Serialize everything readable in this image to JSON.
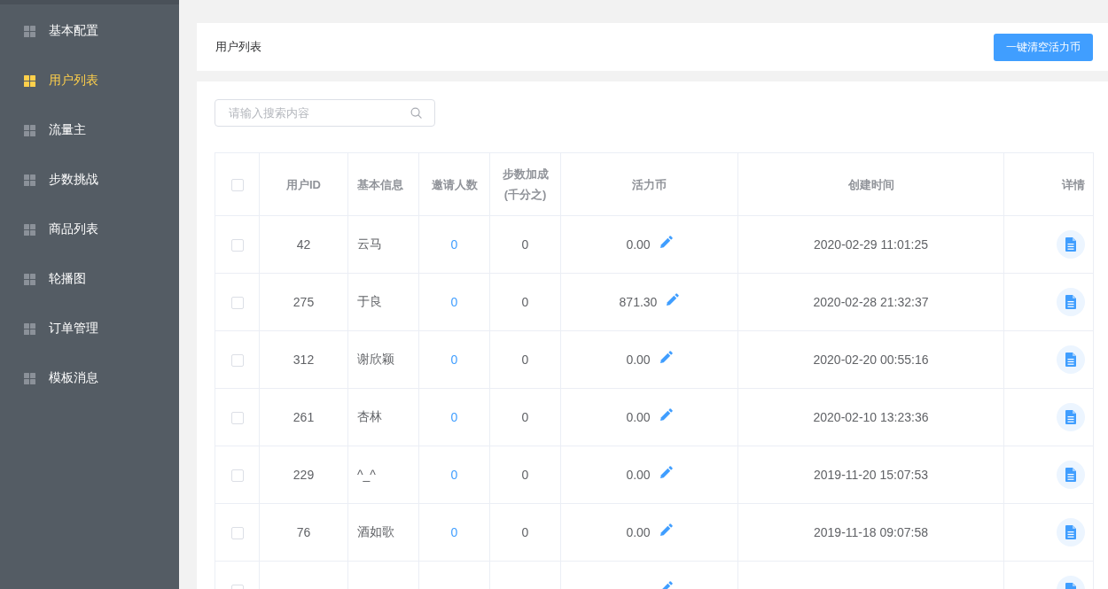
{
  "sidebar": {
    "items": [
      {
        "label": "基本配置",
        "selected": false
      },
      {
        "label": "用户列表",
        "selected": true
      },
      {
        "label": "流量主",
        "selected": false
      },
      {
        "label": "步数挑战",
        "selected": false
      },
      {
        "label": "商品列表",
        "selected": false
      },
      {
        "label": "轮播图",
        "selected": false
      },
      {
        "label": "订单管理",
        "selected": false
      },
      {
        "label": "模板消息",
        "selected": false
      }
    ]
  },
  "header": {
    "title": "用户列表",
    "button": "一键清空活力币"
  },
  "search": {
    "placeholder": "请输入搜索内容"
  },
  "table": {
    "all_checked": false,
    "columns": [
      "用户ID",
      "基本信息",
      "邀请人数",
      "步数加成(千分之)",
      "活力币",
      "创建时间",
      "详情"
    ],
    "rows": [
      {
        "checked": false,
        "id": "42",
        "name": "云马",
        "invites": "0",
        "step_bonus": "0",
        "coins": "0.00",
        "created": "2020-02-29 11:01:25"
      },
      {
        "checked": false,
        "id": "275",
        "name": "于良",
        "invites": "0",
        "step_bonus": "0",
        "coins": "871.30",
        "created": "2020-02-28 21:32:37"
      },
      {
        "checked": false,
        "id": "312",
        "name": "谢欣颖",
        "invites": "0",
        "step_bonus": "0",
        "coins": "0.00",
        "created": "2020-02-20 00:55:16"
      },
      {
        "checked": false,
        "id": "261",
        "name": "杏林",
        "invites": "0",
        "step_bonus": "0",
        "coins": "0.00",
        "created": "2020-02-10 13:23:36"
      },
      {
        "checked": false,
        "id": "229",
        "name": "^_^",
        "invites": "0",
        "step_bonus": "0",
        "coins": "0.00",
        "created": "2019-11-20 15:07:53"
      },
      {
        "checked": false,
        "id": "76",
        "name": "酒如歌",
        "invites": "0",
        "step_bonus": "0",
        "coins": "0.00",
        "created": "2019-11-18 09:07:58"
      },
      {
        "checked": false
      }
    ]
  }
}
